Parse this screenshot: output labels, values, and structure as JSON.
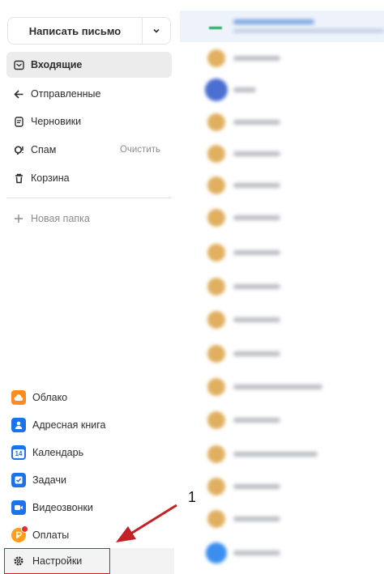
{
  "compose": {
    "label": "Написать письмо"
  },
  "folders": [
    {
      "label": "Входящие",
      "icon": "inbox-icon",
      "active": true
    },
    {
      "label": "Отправленные",
      "icon": "sent-icon"
    },
    {
      "label": "Черновики",
      "icon": "drafts-icon"
    },
    {
      "label": "Спам",
      "icon": "spam-icon",
      "action": "Очистить"
    },
    {
      "label": "Корзина",
      "icon": "trash-icon"
    }
  ],
  "new_folder": {
    "label": "Новая папка"
  },
  "apps": [
    {
      "label": "Облако",
      "icon": "cloud-icon",
      "color": "#ff8a1f"
    },
    {
      "label": "Адресная книга",
      "icon": "contacts-icon",
      "color": "#1a73e8"
    },
    {
      "label": "Календарь",
      "icon": "calendar-icon",
      "color": "#1a73e8",
      "badge_text": "14"
    },
    {
      "label": "Задачи",
      "icon": "tasks-icon",
      "color": "#1a73e8"
    },
    {
      "label": "Видеозвонки",
      "icon": "video-icon",
      "color": "#1a73e8"
    },
    {
      "label": "Оплаты",
      "icon": "payments-icon",
      "color": "#ff9e1b"
    },
    {
      "label": "Настройки",
      "icon": "gear-icon"
    }
  ],
  "annotation": {
    "number": "1",
    "color": "#c42127"
  },
  "colors": {
    "active_bg": "#ececed",
    "accent": "#1a73e8",
    "highlight": "#c42127"
  }
}
